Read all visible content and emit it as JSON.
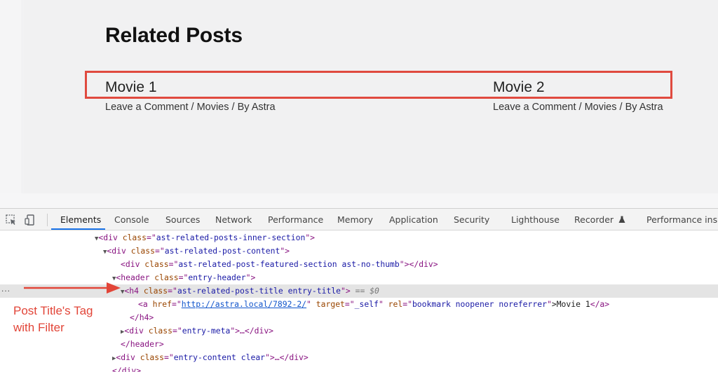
{
  "page": {
    "heading": "Related Posts",
    "posts": [
      {
        "title": "Movie 1",
        "meta": "Leave a Comment / Movies / By Astra"
      },
      {
        "title": "Movie 2",
        "meta": "Leave a Comment / Movies / By Astra"
      }
    ]
  },
  "devtools": {
    "tabs": [
      "Elements",
      "Console",
      "Sources",
      "Network",
      "Performance",
      "Memory",
      "Application",
      "Security",
      "Lighthouse",
      "Recorder",
      "Performance insig"
    ],
    "active_tab": "Elements",
    "recorder_icon": "flask-icon",
    "accent_color": "#1a73e8",
    "left_ellipsis": "...",
    "lines": {
      "l1": {
        "open": "<div",
        "attr": "class",
        "eq": "=\"",
        "val": "ast-related-posts-inner-section",
        "close": "\">"
      },
      "l2": {
        "open": "<div",
        "attr": "class",
        "eq": "=\"",
        "val": "ast-related-post-content",
        "close": "\">"
      },
      "l3": {
        "open": "<div",
        "attr": "class",
        "eq": "=\"",
        "val": "ast-related-post-featured-section ast-no-thumb",
        "close": "\"></div>"
      },
      "l4": {
        "open": "<header",
        "attr": "class",
        "eq": "=\"",
        "val": "entry-header",
        "close": "\">"
      },
      "l5": {
        "open": "<h4",
        "attr": "class",
        "eq": "=\"",
        "val": "ast-related-post-title entry-title",
        "close": "\">",
        "suffix": "== $0"
      },
      "l6": {
        "open": "<a",
        "attr1": "href",
        "val1": "http://astra.local/7892-2/",
        "attr2": "target",
        "val2": "_self",
        "attr3": "rel",
        "val3": "bookmark noopener noreferrer",
        "text": ">Movie 1",
        "close": "</a>"
      },
      "l7": {
        "close": "</h4>"
      },
      "l8": {
        "open": "<div",
        "attr": "class",
        "eq": "=\"",
        "val": "entry-meta",
        "close": "\">…</div>"
      },
      "l9": {
        "close": "</header>"
      },
      "l10": {
        "open": "<div",
        "attr": "class",
        "eq": "=\"",
        "val": "entry-content clear",
        "close": "\">…</div>"
      },
      "l11": {
        "close": "</div>"
      }
    }
  },
  "annotation": {
    "line1": "Post Title's Tag",
    "line2": "with Filter",
    "color": "#e24538"
  }
}
